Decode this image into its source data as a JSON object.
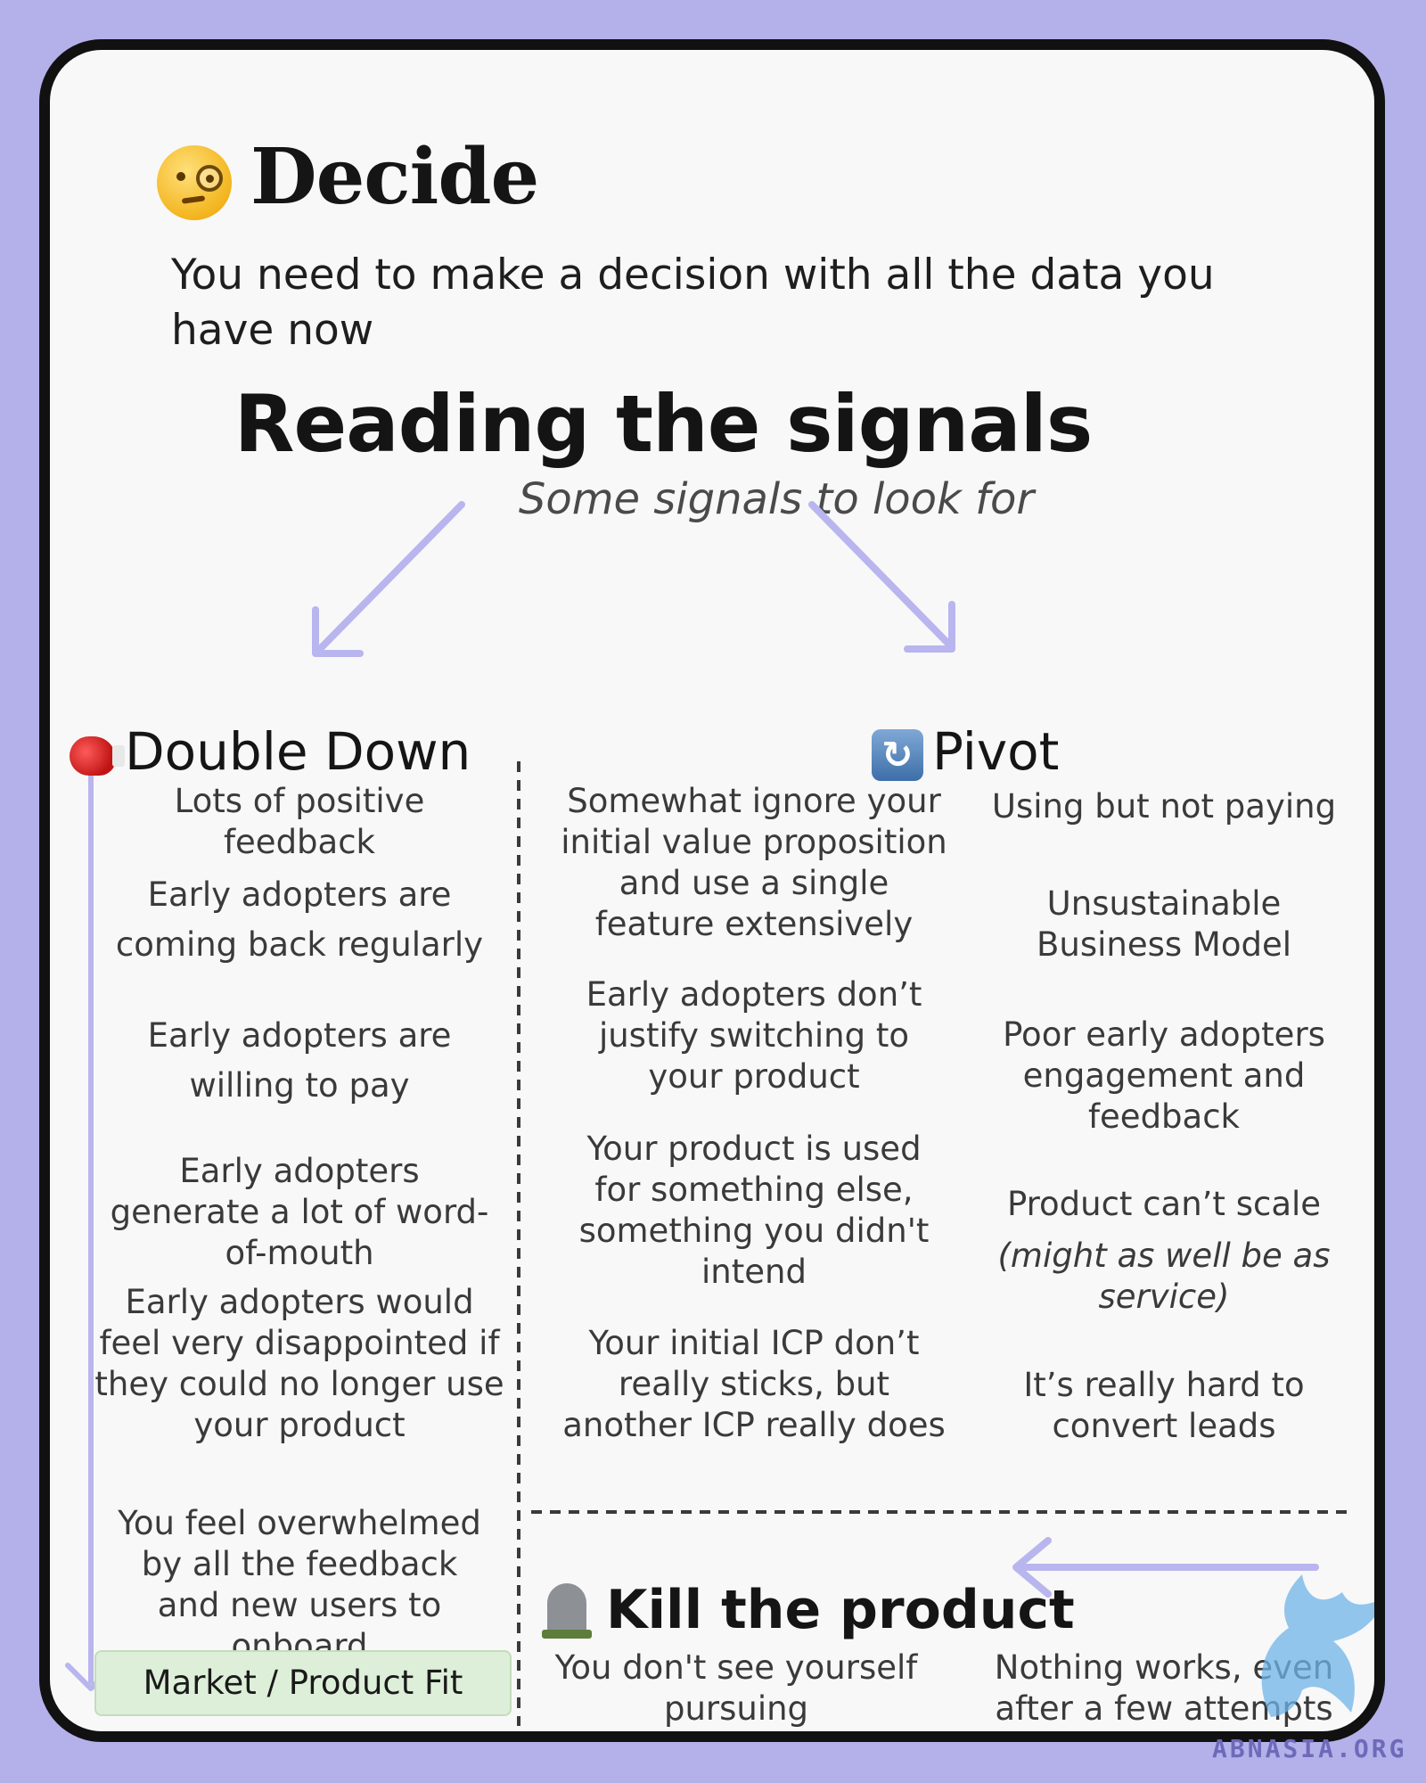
{
  "header": {
    "title": "Decide",
    "emoji": "face-with-monocle-icon",
    "subtitle": "You need to make a decision with all the data you have now"
  },
  "section": {
    "title": "Reading the signals",
    "subtitle": "Some signals to look for"
  },
  "double_down": {
    "heading": "Double  Down",
    "icon": "boxing-glove-icon",
    "items": [
      "Lots of positive feedback",
      "Early adopters are coming back regularly",
      "Early adopters are willing to pay",
      "Early adopters generate a lot of word-of-mouth",
      "Early adopters would feel very disappointed if they could no longer use your product",
      "You feel overwhelmed by all the feedback and new users to onboard"
    ],
    "outcome": "Market / Product Fit"
  },
  "pivot": {
    "heading": "Pivot",
    "icon": "arrows-cycle-icon",
    "left_items": [
      "Somewhat ignore your initial value proposition and use a single feature extensively",
      "Early adopters don’t justify switching to your product",
      "Your product is used for something else, something you didn't intend",
      "Your initial ICP don’t really sticks, but another ICP really does"
    ],
    "right_items": [
      "Using but not paying",
      "Unsustainable Business Model",
      "Poor early adopters engagement and feedback",
      "Product can’t scale",
      "It’s really hard to convert leads"
    ],
    "right_items_italic_note": "(might as well be as service)"
  },
  "kill": {
    "heading": "Kill the product",
    "icon": "headstone-icon",
    "left_text": "You don't see yourself pursuing",
    "right_text": "Nothing works, even after a few attempts"
  },
  "watermark": "ABNASIA.ORG",
  "colors": {
    "background": "#b4b1ea",
    "card": "#f8f8f8",
    "border": "#111111",
    "arrow": "#b9b5ee",
    "fit_box": "#ddefd8"
  }
}
